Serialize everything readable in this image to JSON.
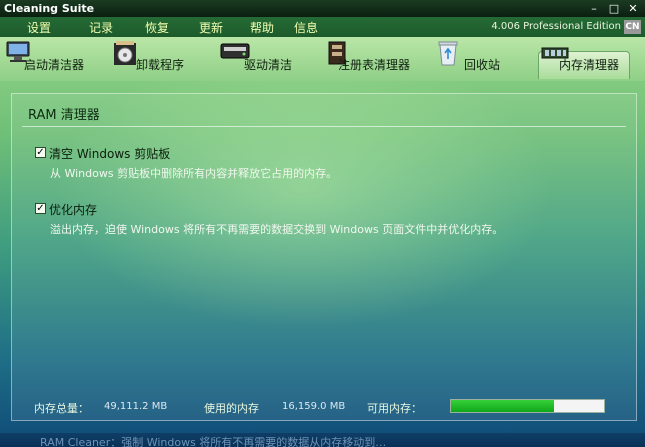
{
  "window": {
    "title": "Cleaning Suite",
    "edition": "4.006 Professional Edition",
    "lang": "CN"
  },
  "menu": [
    "设置",
    "记录",
    "恢复",
    "更新",
    "帮助",
    "信息"
  ],
  "tabs": [
    {
      "label": "启动清洁器",
      "icon": "startup-cleaner-icon"
    },
    {
      "label": "卸载程序",
      "icon": "uninstaller-icon"
    },
    {
      "label": "驱动清洁",
      "icon": "drive-cleaner-icon"
    },
    {
      "label": "注册表清理器",
      "icon": "registry-cleaner-icon"
    },
    {
      "label": "回收站",
      "icon": "recycle-bin-icon"
    },
    {
      "label": "内存清理器",
      "icon": "memory-cleaner-icon",
      "active": true
    }
  ],
  "panel": {
    "title": "RAM 清理器",
    "options": [
      {
        "label": "清空 Windows 剪贴板",
        "checked": true,
        "description": "从 Windows 剪贴板中删除所有内容并释放它占用的内存。"
      },
      {
        "label": "优化内存",
        "checked": true,
        "description": "溢出内存，迫使 Windows 将所有不再需要的数据交换到 Windows 页面文件中并优化内存。"
      }
    ]
  },
  "status": {
    "total_label": "内存总量：",
    "total_value": "49,111.2 MB",
    "used_label": "使用的内存",
    "used_value": "16,159.0 MB",
    "available_label": "可用内存：",
    "available_fraction": 0.67
  },
  "bottom_text": "RAM Cleaner：强制 Windows 将所有不再需要的数据从内存移动到…",
  "colors": {
    "accent": "#1fb01f",
    "menu_text": "#f2ffb0"
  }
}
